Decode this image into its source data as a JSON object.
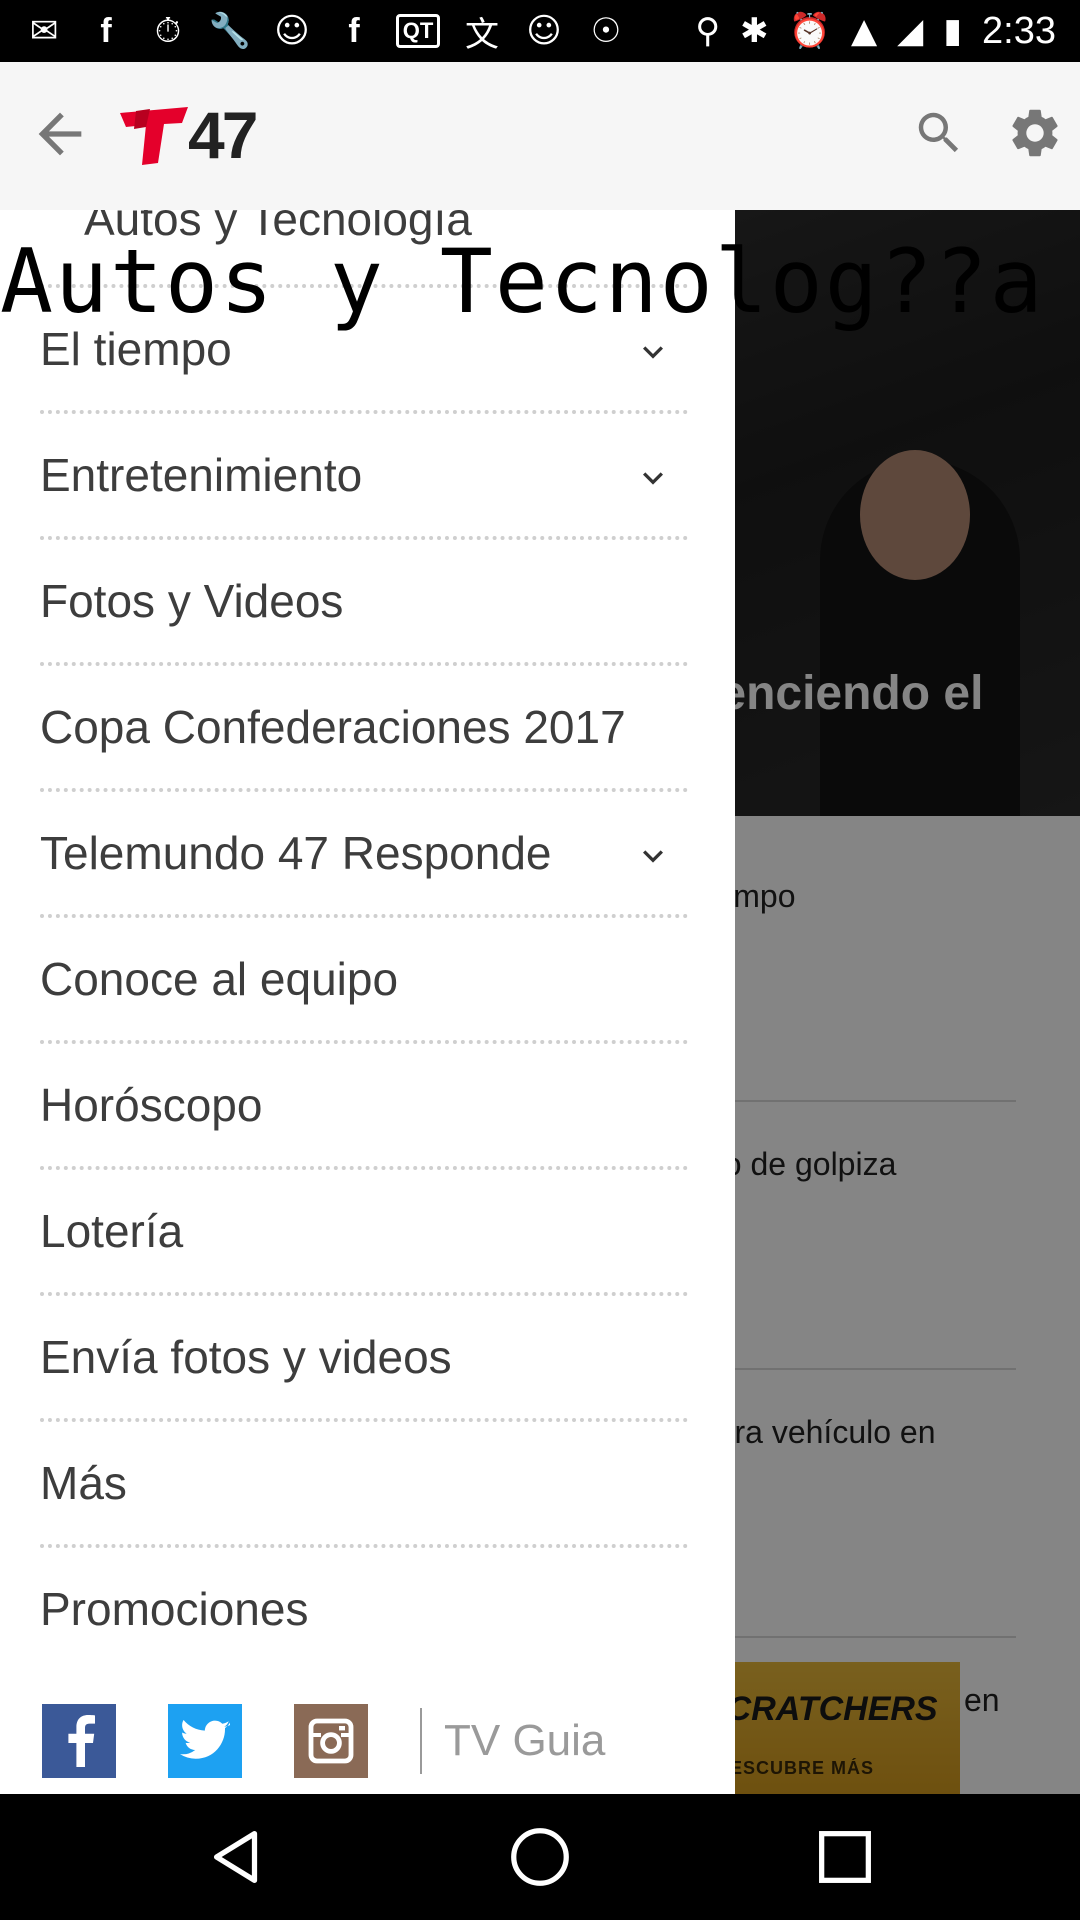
{
  "status_bar": {
    "time": "2:33",
    "left_icons": [
      "message-icon",
      "facebook-icon",
      "timer-icon",
      "wrench-icon",
      "smiley-icon",
      "facebook-icon",
      "qt-icon",
      "translate-icon",
      "smiley-icon",
      "media-icon"
    ],
    "right_icons": [
      "location-icon",
      "bluetooth-icon",
      "alarm-icon",
      "wifi-icon",
      "signal-icon",
      "battery-icon"
    ]
  },
  "app_bar": {
    "logo_number": "47",
    "logo_color": "#e4002b",
    "icons": [
      "back-arrow-icon",
      "search-icon",
      "gear-icon"
    ]
  },
  "overlay_title": "Autos y Tecnolog??a",
  "drawer": {
    "partial_item": "Autos y Tecnología",
    "items": [
      {
        "label": "El tiempo",
        "expandable": true
      },
      {
        "label": "Entretenimiento",
        "expandable": true
      },
      {
        "label": "Fotos y Videos",
        "expandable": false
      },
      {
        "label": "Copa Confederaciones 2017",
        "expandable": false
      },
      {
        "label": "Telemundo 47 Responde",
        "expandable": true
      },
      {
        "label": "Conoce al equipo",
        "expandable": false
      },
      {
        "label": "Horóscopo",
        "expandable": false
      },
      {
        "label": "Lotería",
        "expandable": false
      },
      {
        "label": "Envía fotos y videos",
        "expandable": false
      },
      {
        "label": "Más",
        "expandable": false
      },
      {
        "label": "Promociones",
        "expandable": false
      }
    ],
    "footer": {
      "social": [
        "facebook-icon",
        "twitter-icon",
        "instagram-icon"
      ],
      "tv_guia": "TV Guia"
    }
  },
  "background": {
    "hero_headline": "Venciendo el",
    "articles": [
      "Tiempo",
      "oso de golpiza",
      "ontra vehículo en",
      "en"
    ],
    "ad_text": "SCRATCHERS",
    "ad_subtext": "DESCUBRE MÁS"
  },
  "colors": {
    "facebook": "#3b5998",
    "twitter": "#1da1f2",
    "instagram": "#8a6a56",
    "menu_text": "#3d3d3d"
  }
}
